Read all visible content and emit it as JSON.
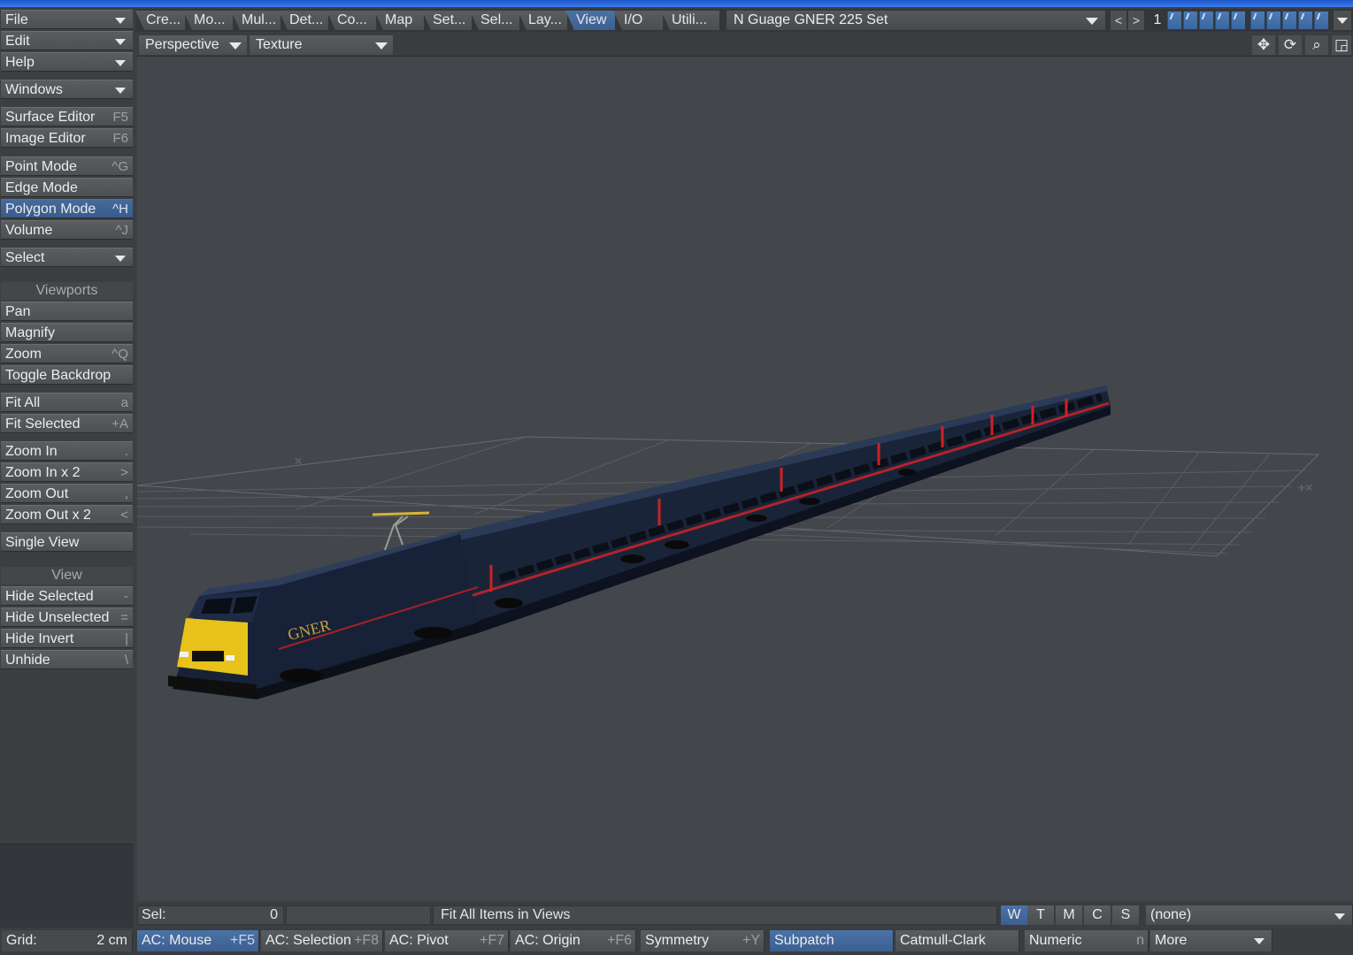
{
  "sidebar": {
    "file": "File",
    "edit": "Edit",
    "help": "Help",
    "windows": "Windows",
    "surface_editor": {
      "label": "Surface Editor",
      "shortcut": "F5"
    },
    "image_editor": {
      "label": "Image Editor",
      "shortcut": "F6"
    },
    "point_mode": {
      "label": "Point Mode",
      "shortcut": "^G"
    },
    "edge_mode": {
      "label": "Edge Mode",
      "shortcut": ""
    },
    "polygon_mode": {
      "label": "Polygon Mode",
      "shortcut": "^H"
    },
    "volume": {
      "label": "Volume",
      "shortcut": "^J"
    },
    "select": "Select",
    "viewports_header": "Viewports",
    "pan": "Pan",
    "magnify": "Magnify",
    "zoom": {
      "label": "Zoom",
      "shortcut": "^Q"
    },
    "toggle_backdrop": "Toggle Backdrop",
    "fit_all": {
      "label": "Fit All",
      "shortcut": "a"
    },
    "fit_selected": {
      "label": "Fit Selected",
      "shortcut": "+A"
    },
    "zoom_in": {
      "label": "Zoom In",
      "shortcut": "."
    },
    "zoom_in_x2": {
      "label": "Zoom In x 2",
      "shortcut": ">"
    },
    "zoom_out": {
      "label": "Zoom Out",
      "shortcut": ","
    },
    "zoom_out_x2": {
      "label": "Zoom Out x 2",
      "shortcut": "<"
    },
    "single_view": "Single View",
    "view_header": "View",
    "hide_selected": {
      "label": "Hide Selected",
      "shortcut": "-"
    },
    "hide_unselected": {
      "label": "Hide Unselected",
      "shortcut": "="
    },
    "hide_invert": {
      "label": "Hide Invert",
      "shortcut": "|"
    },
    "unhide": {
      "label": "Unhide",
      "shortcut": "\\"
    }
  },
  "tabs": [
    "Cre...",
    "Mo...",
    "Mul...",
    "Det...",
    "Co...",
    "Map",
    "Set...",
    "Sel...",
    "Lay...",
    "View",
    "I/O",
    "Utili..."
  ],
  "active_tab": "View",
  "layer_dropdown": "N Guage GNER 225 Set",
  "layer_number": "1",
  "nav": {
    "prev": "<",
    "next": ">"
  },
  "viewport": {
    "projection": "Perspective",
    "render_mode": "Texture",
    "icons": [
      "move-view-icon",
      "rotate-view-icon",
      "zoom-view-icon",
      "maximize-view-icon"
    ],
    "train_logo": "GNER",
    "colors": {
      "background": "#43474b",
      "train_body": "#16233a",
      "stripe": "#b3232a",
      "nose": "#e8c21a"
    }
  },
  "status": {
    "sel_label": "Sel:",
    "sel_value": "0",
    "hint": "Fit All Items in Views",
    "wtmcs": [
      "W",
      "T",
      "M",
      "C",
      "S"
    ],
    "active_wtmcs": "W",
    "surface": "(none)",
    "grid_label": "Grid:",
    "grid_value": "2 cm",
    "ac_mouse": {
      "label": "AC: Mouse",
      "shortcut": "+F5"
    },
    "ac_selection": {
      "label": "AC: Selection",
      "shortcut": "+F8"
    },
    "ac_pivot": {
      "label": "AC: Pivot",
      "shortcut": "+F7"
    },
    "ac_origin": {
      "label": "AC: Origin",
      "shortcut": "+F6"
    },
    "symmetry": {
      "label": "Symmetry",
      "shortcut": "+Y"
    },
    "subpatch": "Subpatch",
    "catmull": "Catmull-Clark",
    "numeric": {
      "label": "Numeric",
      "shortcut": "n"
    },
    "more": "More"
  }
}
